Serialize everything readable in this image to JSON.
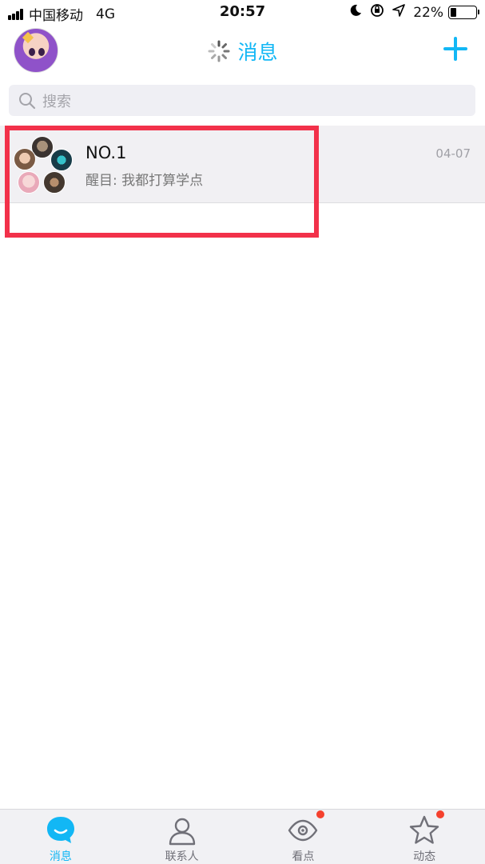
{
  "status_bar": {
    "carrier": "中国移动",
    "network": "4G",
    "time": "20:57",
    "battery_percent": "22%",
    "battery_level": 0.22,
    "icons": [
      "signal-bars-icon",
      "moon-icon",
      "orientation-lock-icon",
      "location-icon",
      "battery-icon"
    ]
  },
  "header": {
    "title": "消息",
    "avatar_icon": "user-avatar",
    "left_icon": "loading-spinner-icon",
    "right_icon": "plus-icon",
    "accent_color": "#12b7f5"
  },
  "search": {
    "placeholder": "搜索",
    "icon": "search-icon"
  },
  "conversations": [
    {
      "name": "NO.1",
      "last_message": "醒目: 我都打算学点",
      "date": "04-07",
      "avatar": "group-avatar"
    }
  ],
  "highlight": {
    "color": "#f2314a"
  },
  "tabbar": {
    "tabs": [
      {
        "label": "消息",
        "icon": "message-bubble-icon",
        "active": true,
        "badge": false
      },
      {
        "label": "联系人",
        "icon": "contacts-icon",
        "active": false,
        "badge": false
      },
      {
        "label": "看点",
        "icon": "eye-icon",
        "active": false,
        "badge": true
      },
      {
        "label": "动态",
        "icon": "star-icon",
        "active": false,
        "badge": true
      }
    ],
    "badge_color": "#f5412e"
  }
}
